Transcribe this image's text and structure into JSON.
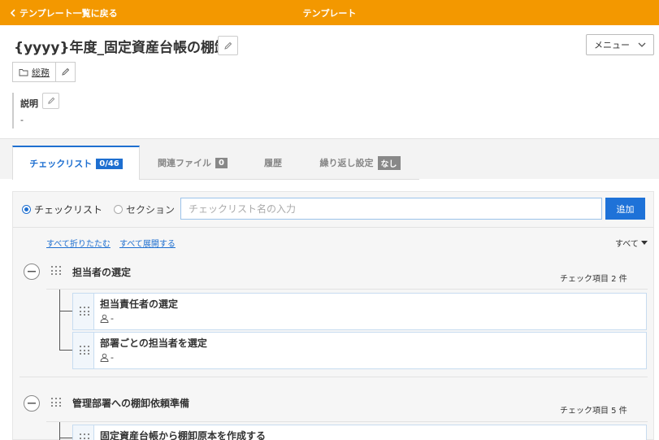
{
  "topbar": {
    "back_label": "テンプレート一覧に戻る",
    "title": "テンプレート",
    "accent_color": "#f39800"
  },
  "page": {
    "title": "{yyyy}年度_固定資産台帳の棚卸",
    "menu_label": "メニュー",
    "folder_label": "総務",
    "description_label": "説明",
    "description_value": "-"
  },
  "tabs": [
    {
      "label": "チェックリスト",
      "badge": "0/46",
      "active": true
    },
    {
      "label": "関連ファイル",
      "badge": "0",
      "active": false
    },
    {
      "label": "履歴",
      "badge": "",
      "active": false
    },
    {
      "label": "繰り返し設定",
      "badge": "なし",
      "active": false
    }
  ],
  "creator": {
    "radio_checklist": "チェックリスト",
    "radio_section": "セクション",
    "selected": "チェックリスト",
    "input_placeholder": "チェックリスト名の入力",
    "input_value": "",
    "add_label": "追加"
  },
  "controls": {
    "collapse_all": "すべて折りたたむ",
    "expand_all": "すべて展開する",
    "filter_label": "すべて"
  },
  "sections": [
    {
      "title": "担当者の選定",
      "count": "チェック項目 2 件",
      "items": [
        {
          "title": "担当責任者の選定",
          "assignee": "-"
        },
        {
          "title": "部署ごとの担当者を選定",
          "assignee": "-"
        }
      ]
    },
    {
      "title": "管理部署への棚卸依頼準備",
      "count": "チェック項目 5 件",
      "items": [
        {
          "title": "固定資産台帳から棚卸原本を作成する",
          "assignee": ""
        }
      ]
    }
  ],
  "colors": {
    "primary": "#1e72d8",
    "link": "#1e6fd0"
  }
}
